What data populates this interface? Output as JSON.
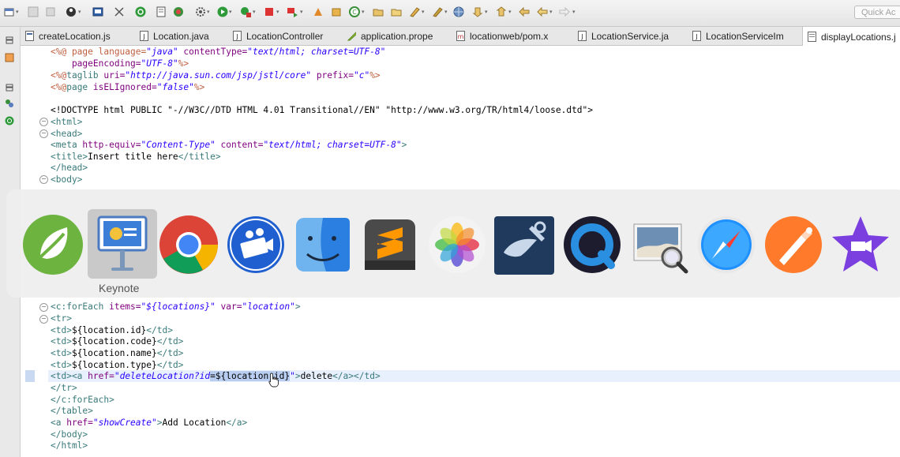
{
  "toolbar": {
    "quick_access_placeholder": "Quick Ac",
    "icons": [
      "new-icon",
      "save-icon",
      "save-all-icon",
      "person-icon",
      "terminal-icon",
      "debug-icon",
      "power-icon",
      "page-icon",
      "refresh-icon",
      "settings-icon",
      "run-icon",
      "run-config-icon",
      "stop-icon",
      "flag-icon",
      "build-icon",
      "package-icon",
      "gear-icon",
      "open-folder-icon",
      "folder-icon",
      "pen-icon",
      "globe-icon",
      "down-icon",
      "up-icon",
      "back-icon",
      "forward-icon"
    ]
  },
  "tabs": [
    {
      "label": "createLocation.js",
      "icon": "js-file-icon"
    },
    {
      "label": "Location.java",
      "icon": "java-file-icon"
    },
    {
      "label": "LocationController",
      "icon": "java-file-icon"
    },
    {
      "label": "application.prope",
      "icon": "properties-file-icon"
    },
    {
      "label": "locationweb/pom.x",
      "icon": "maven-file-icon"
    },
    {
      "label": "LocationService.ja",
      "icon": "java-file-icon"
    },
    {
      "label": "LocationServiceIm",
      "icon": "java-file-icon"
    },
    {
      "label": "displayLocations.j",
      "icon": "jsp-file-icon"
    }
  ],
  "code": {
    "l1": {
      "a": "<%@ page language=",
      "b": "\"java\"",
      "c": " contentType=",
      "d": "\"text/html; charset=UTF-8\""
    },
    "l2": {
      "a": "    pageEncoding=",
      "b": "\"UTF-8\"",
      "c": "%>"
    },
    "l3": {
      "a": "<%@",
      "b": "taglib",
      "c": " uri=",
      "d": "\"http://java.sun.com/jsp/jstl/core\"",
      "e": " prefix=",
      "f": "\"c\"",
      "g": "%>"
    },
    "l4": {
      "a": "<%@",
      "b": "page",
      "c": " isELIgnored=",
      "d": "\"false\"",
      "e": "%>"
    },
    "l5": "<!DOCTYPE html PUBLIC \"-//W3C//DTD HTML 4.01 Transitional//EN\" \"http://www.w3.org/TR/html4/loose.dtd\">",
    "l6": "<html>",
    "l7": "<head>",
    "l8": {
      "a": "<meta",
      "b": " http-equiv=",
      "c": "\"Content-Type\"",
      "d": " content=",
      "e": "\"text/html; charset=UTF-8\"",
      "f": ">"
    },
    "l9": {
      "a": "<title>",
      "b": "Insert title here",
      "c": "</title>"
    },
    "l10": "</head>",
    "l11": "<body>",
    "l12": {
      "a": "<c:forEach",
      "b": " items=",
      "c": "\"${locations}\"",
      "d": " var=",
      "e": "\"location\"",
      "f": ">"
    },
    "l13": "<tr>",
    "l14": {
      "a": "<td>",
      "b": "${location.id}",
      "c": "</td>"
    },
    "l15": {
      "a": "<td>",
      "b": "${location.code}",
      "c": "</td>"
    },
    "l16": {
      "a": "<td>",
      "b": "${location.name}",
      "c": "</td>"
    },
    "l17": {
      "a": "<td>",
      "b": "${location.type}",
      "c": "</td>"
    },
    "l18": {
      "a": "<td><a",
      "b": " href=",
      "c": "\"deleteLocation?id",
      "d": "=${location.id}",
      "e": "\"",
      "f": ">",
      "g": "delete",
      "h": "</a></td>"
    },
    "l19": "</tr>",
    "l20": "</c:forEach>",
    "l21": "</table>",
    "l22": {
      "a": "<a",
      "b": " href=",
      "c": "\"showCreate\"",
      "d": ">",
      "e": "Add Location",
      "f": "</a>"
    },
    "l23": "</body>",
    "l24": "</html>"
  },
  "dock": {
    "selected_label": "Keynote",
    "apps": [
      "spring-tool-suite-icon",
      "keynote-icon",
      "chrome-icon",
      "screen-recorder-icon",
      "finder-icon",
      "sublime-text-icon",
      "photos-icon",
      "mysql-workbench-icon",
      "quicktime-icon",
      "preview-icon",
      "safari-icon",
      "pencil-app-icon",
      "imovie-icon"
    ]
  },
  "colors": {
    "tag": "#3a7a7a",
    "attr_name": "#7f007f",
    "attr_value": "#2a00ff",
    "directive": "#bf5f3f",
    "selection": "#b8cdf0"
  }
}
